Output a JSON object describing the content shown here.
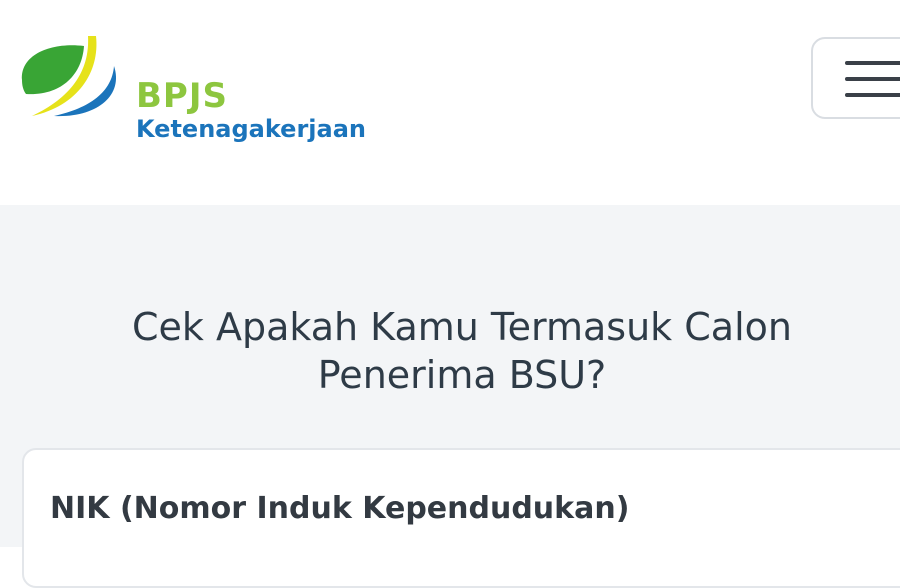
{
  "brand": {
    "title": "BPJS",
    "subtitle": "Ketenagakerjaan",
    "logo_icon": "bpjs-leaf-logo",
    "colors": {
      "green": "#8dc63f",
      "leaf_green": "#39a535",
      "yellow": "#e6e21a",
      "blue": "#1b74bb"
    }
  },
  "header": {
    "menu_icon": "hamburger-menu-icon"
  },
  "main": {
    "title_line1": "Cek Apakah Kamu Termasuk Calon",
    "title_line2": "Penerima BSU?",
    "form": {
      "nik_label": "NIK (Nomor Induk Kependudukan)"
    }
  }
}
